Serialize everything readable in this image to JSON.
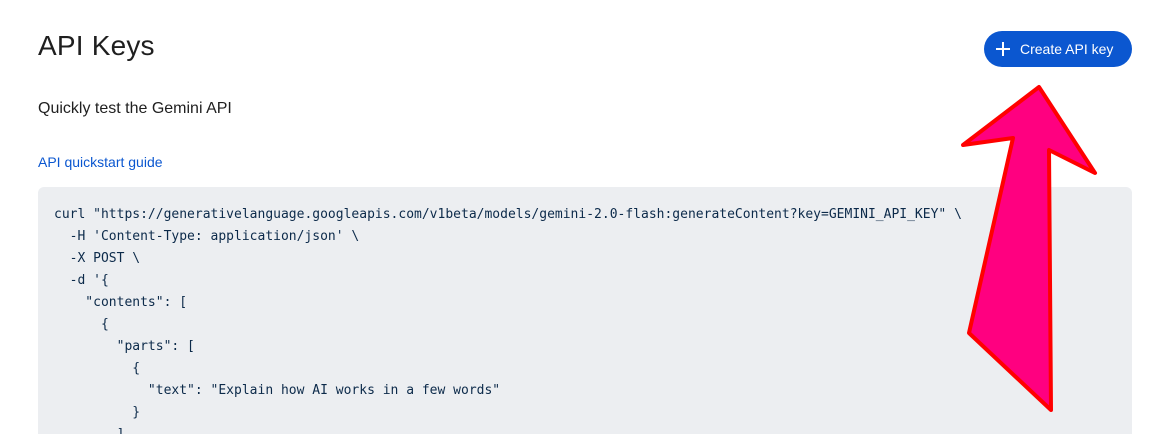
{
  "header": {
    "title": "API Keys",
    "create_button_label": "Create API key",
    "create_button_icon": "plus-icon"
  },
  "main": {
    "subtitle": "Quickly test the Gemini API",
    "quickstart_link": "API quickstart guide",
    "code_lines": [
      "curl \"https://generativelanguage.googleapis.com/v1beta/models/gemini-2.0-flash:generateContent?key=GEMINI_API_KEY\" \\",
      "  -H 'Content-Type: application/json' \\",
      "  -X POST \\",
      "  -d '{",
      "    \"contents\": [",
      "      {",
      "        \"parts\": [",
      "          {",
      "            \"text\": \"Explain how AI works in a few words\"",
      "          }",
      "        ]"
    ]
  },
  "colors": {
    "accent": "#0b57d0",
    "code_background": "#eceef1",
    "annotation_arrow_fill": "#ff0080",
    "annotation_arrow_stroke": "#ff0000"
  }
}
